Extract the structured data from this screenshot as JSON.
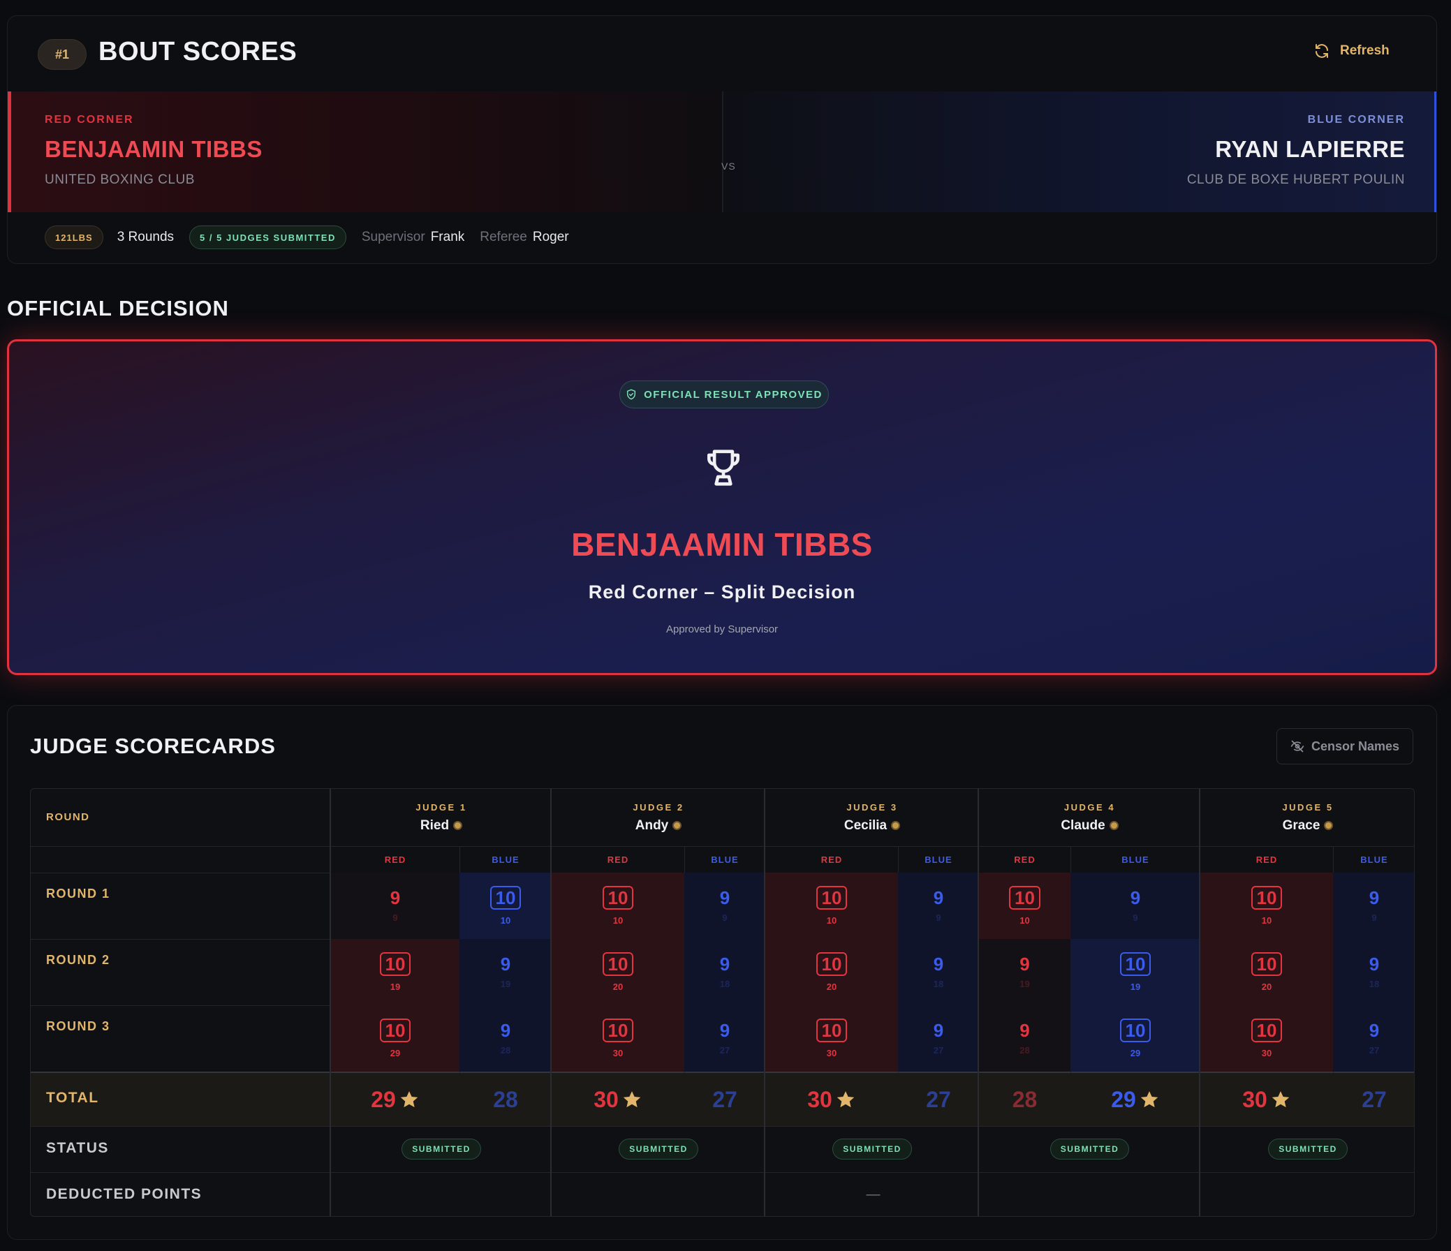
{
  "header": {
    "bout_number": "#1",
    "title": "BOUT SCORES",
    "refresh_label": "Refresh"
  },
  "red_corner": {
    "label": "RED CORNER",
    "name": "BENJAAMIN TIBBS",
    "club": "UNITED BOXING CLUB",
    "color": "#e0333f"
  },
  "blue_corner": {
    "label": "BLUE CORNER",
    "name": "RYAN LAPIERRE",
    "club": "CLUB DE BOXE HUBERT POULIN",
    "color": "#2f4fdc"
  },
  "vs": "VS",
  "meta": {
    "weight": "121LBS",
    "rounds": "3 Rounds",
    "judges_submitted": "5 / 5 JUDGES SUBMITTED",
    "supervisor_label": "Supervisor",
    "supervisor": "Frank",
    "referee_label": "Referee",
    "referee": "Roger"
  },
  "decision": {
    "section_title": "OFFICIAL DECISION",
    "status": "OFFICIAL RESULT APPROVED",
    "winner": "BENJAAMIN TIBBS",
    "decision_type": "Red Corner – Split Decision",
    "approved_by": "Approved by Supervisor"
  },
  "scorecards": {
    "section_title": "JUDGE SCORECARDS",
    "censor_label": "Censor Names",
    "round_header": "ROUND",
    "red_label": "RED",
    "blue_label": "BLUE",
    "total_label": "TOTAL",
    "status_label": "STATUS",
    "deducted_label": "DEDUCTED POINTS",
    "deducted_value": "—",
    "rounds": [
      "ROUND 1",
      "ROUND 2",
      "ROUND 3"
    ],
    "judges": [
      {
        "label": "JUDGE 1",
        "name": "Ried",
        "status": "SUBMITTED",
        "total_red": "29",
        "total_blue": "28",
        "winner": "red",
        "scores": [
          {
            "red": "9",
            "red_cum": "9",
            "blue": "10",
            "blue_cum": "10",
            "won": "blue"
          },
          {
            "red": "10",
            "red_cum": "19",
            "blue": "9",
            "blue_cum": "19",
            "won": "red"
          },
          {
            "red": "10",
            "red_cum": "29",
            "blue": "9",
            "blue_cum": "28",
            "won": "red"
          }
        ]
      },
      {
        "label": "JUDGE 2",
        "name": "Andy",
        "status": "SUBMITTED",
        "total_red": "30",
        "total_blue": "27",
        "winner": "red",
        "scores": [
          {
            "red": "10",
            "red_cum": "10",
            "blue": "9",
            "blue_cum": "9",
            "won": "red"
          },
          {
            "red": "10",
            "red_cum": "20",
            "blue": "9",
            "blue_cum": "18",
            "won": "red"
          },
          {
            "red": "10",
            "red_cum": "30",
            "blue": "9",
            "blue_cum": "27",
            "won": "red"
          }
        ]
      },
      {
        "label": "JUDGE 3",
        "name": "Cecilia",
        "status": "SUBMITTED",
        "total_red": "30",
        "total_blue": "27",
        "winner": "red",
        "scores": [
          {
            "red": "10",
            "red_cum": "10",
            "blue": "9",
            "blue_cum": "9",
            "won": "red"
          },
          {
            "red": "10",
            "red_cum": "20",
            "blue": "9",
            "blue_cum": "18",
            "won": "red"
          },
          {
            "red": "10",
            "red_cum": "30",
            "blue": "9",
            "blue_cum": "27",
            "won": "red"
          }
        ]
      },
      {
        "label": "JUDGE 4",
        "name": "Claude",
        "status": "SUBMITTED",
        "total_red": "28",
        "total_blue": "29",
        "winner": "blue",
        "scores": [
          {
            "red": "10",
            "red_cum": "10",
            "blue": "9",
            "blue_cum": "9",
            "won": "red"
          },
          {
            "red": "9",
            "red_cum": "19",
            "blue": "10",
            "blue_cum": "19",
            "won": "blue"
          },
          {
            "red": "9",
            "red_cum": "28",
            "blue": "10",
            "blue_cum": "29",
            "won": "blue"
          }
        ]
      },
      {
        "label": "JUDGE 5",
        "name": "Grace",
        "status": "SUBMITTED",
        "total_red": "30",
        "total_blue": "27",
        "winner": "red",
        "scores": [
          {
            "red": "10",
            "red_cum": "10",
            "blue": "9",
            "blue_cum": "9",
            "won": "red"
          },
          {
            "red": "10",
            "red_cum": "20",
            "blue": "9",
            "blue_cum": "18",
            "won": "red"
          },
          {
            "red": "10",
            "red_cum": "30",
            "blue": "9",
            "blue_cum": "27",
            "won": "red"
          }
        ]
      }
    ]
  }
}
